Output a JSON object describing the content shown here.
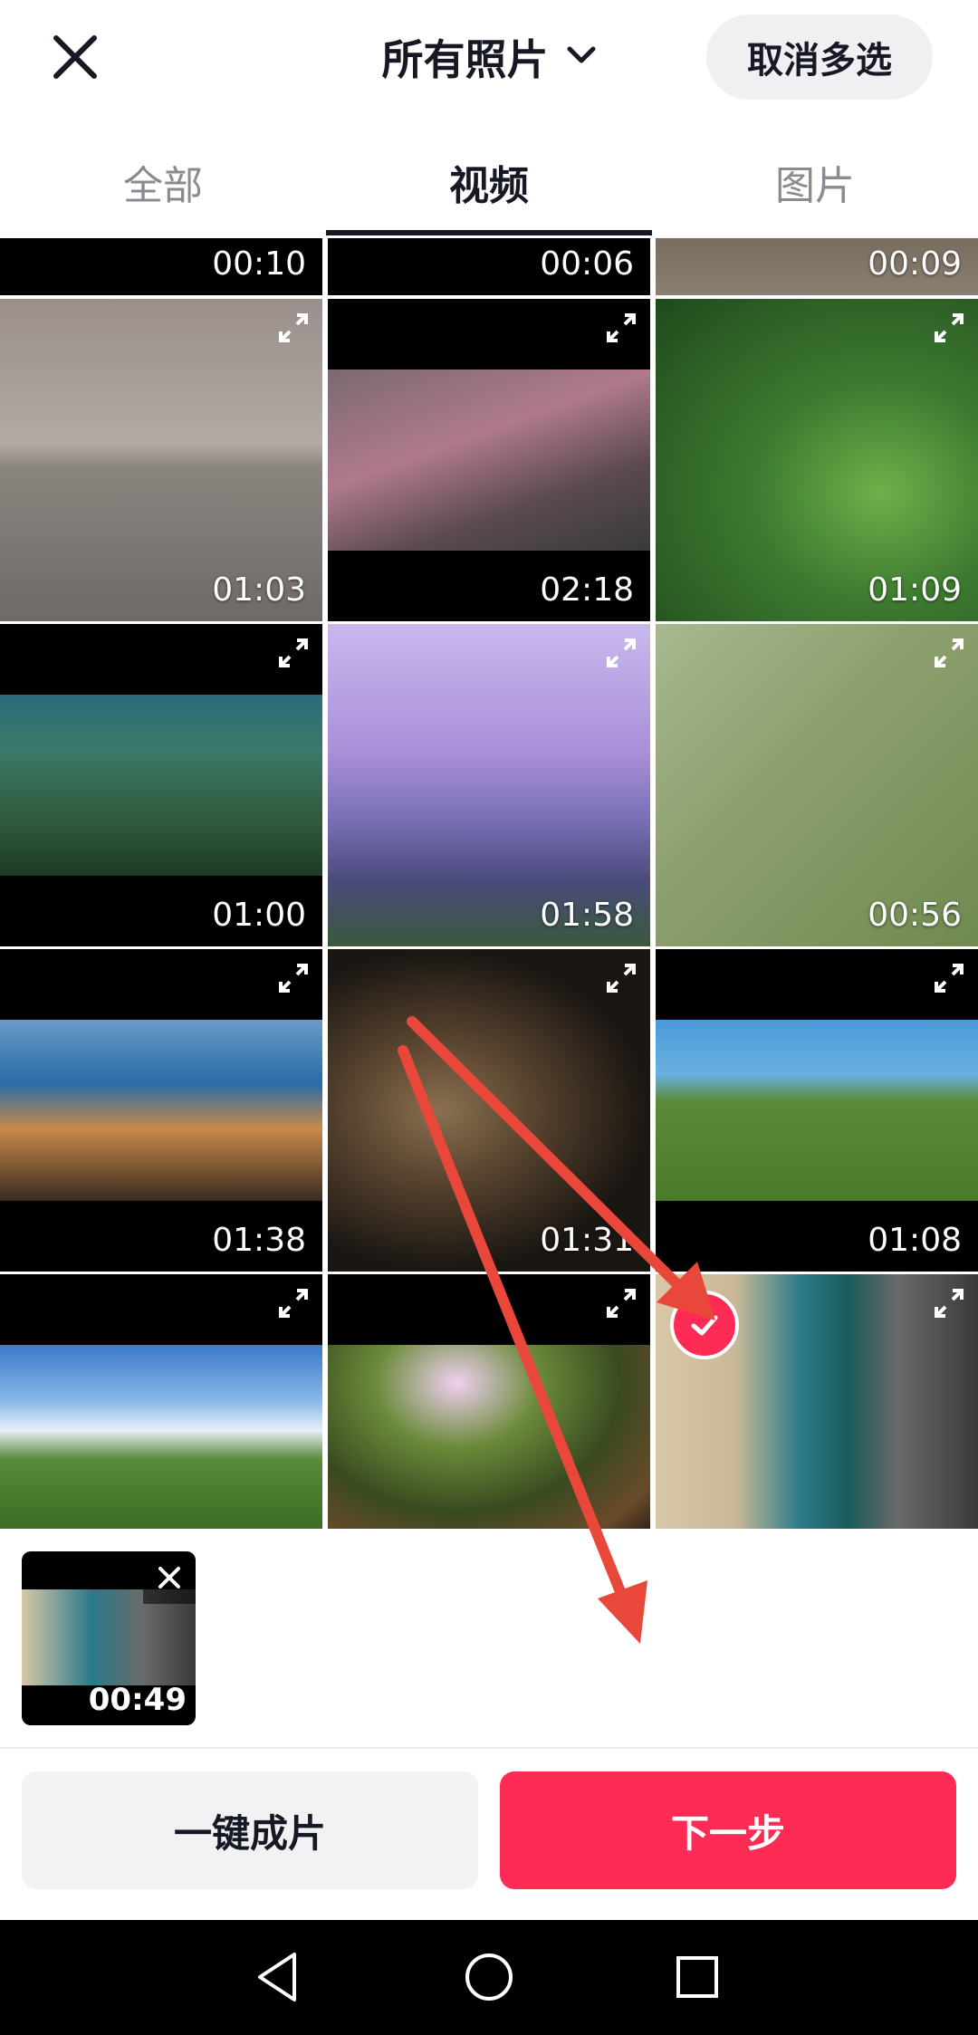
{
  "header": {
    "title": "所有照片",
    "cancel_multiselect": "取消多选"
  },
  "tabs": [
    {
      "label": "全部",
      "active": false
    },
    {
      "label": "视频",
      "active": true
    },
    {
      "label": "图片",
      "active": false
    }
  ],
  "grid": {
    "top_row": [
      {
        "duration": "00:10"
      },
      {
        "duration": "00:06"
      },
      {
        "duration": "00:09"
      }
    ],
    "rows": [
      [
        {
          "duration": "01:03"
        },
        {
          "duration": "02:18"
        },
        {
          "duration": "01:09"
        }
      ],
      [
        {
          "duration": "01:00"
        },
        {
          "duration": "01:58"
        },
        {
          "duration": "00:56"
        }
      ],
      [
        {
          "duration": "01:38"
        },
        {
          "duration": "01:31"
        },
        {
          "duration": "01:08"
        }
      ],
      [
        {
          "duration": ""
        },
        {
          "duration": ""
        },
        {
          "duration": "",
          "selected": true
        }
      ]
    ]
  },
  "selected_tray": {
    "items": [
      {
        "duration": "00:49"
      }
    ]
  },
  "buttons": {
    "auto_make": "一键成片",
    "next": "下一步"
  },
  "colors": {
    "accent": "#fe2c55",
    "text_primary": "#161823",
    "text_secondary": "#8a8b91"
  }
}
